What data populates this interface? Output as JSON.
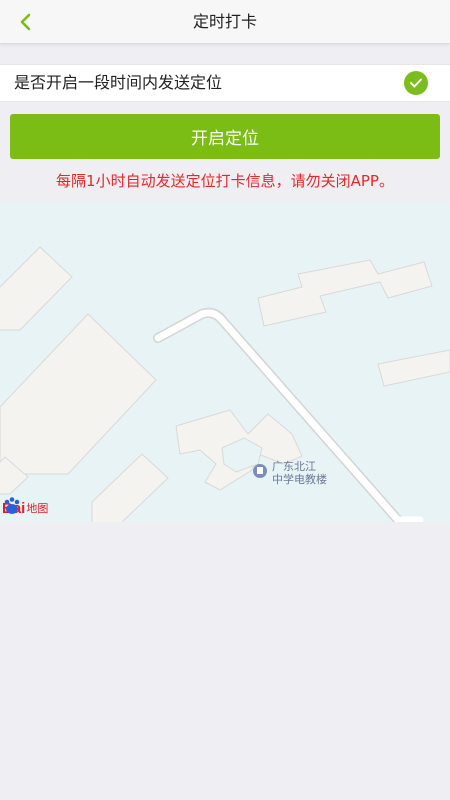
{
  "header": {
    "title": "定时打卡",
    "back_icon": "chevron-left-icon"
  },
  "toggle": {
    "label": "是否开启一段时间内发送定位",
    "checked": true,
    "icon": "check-circle-icon"
  },
  "start_button": {
    "label": "开启定位"
  },
  "notice": {
    "text": "每隔1小时自动发送定位打卡信息，请勿关闭APP。"
  },
  "map": {
    "poi_line1": "广东北江",
    "poi_line2": "中学电教楼",
    "poi_icon": "map-pin-icon",
    "logo_text": "Bai",
    "logo_suffix": "地图",
    "logo_icon": "baidu-paw-icon"
  },
  "colors": {
    "accent": "#7bbd15",
    "notice": "#e52929",
    "map_bg": "#e8f3f5",
    "building": "#f5f3f0"
  }
}
